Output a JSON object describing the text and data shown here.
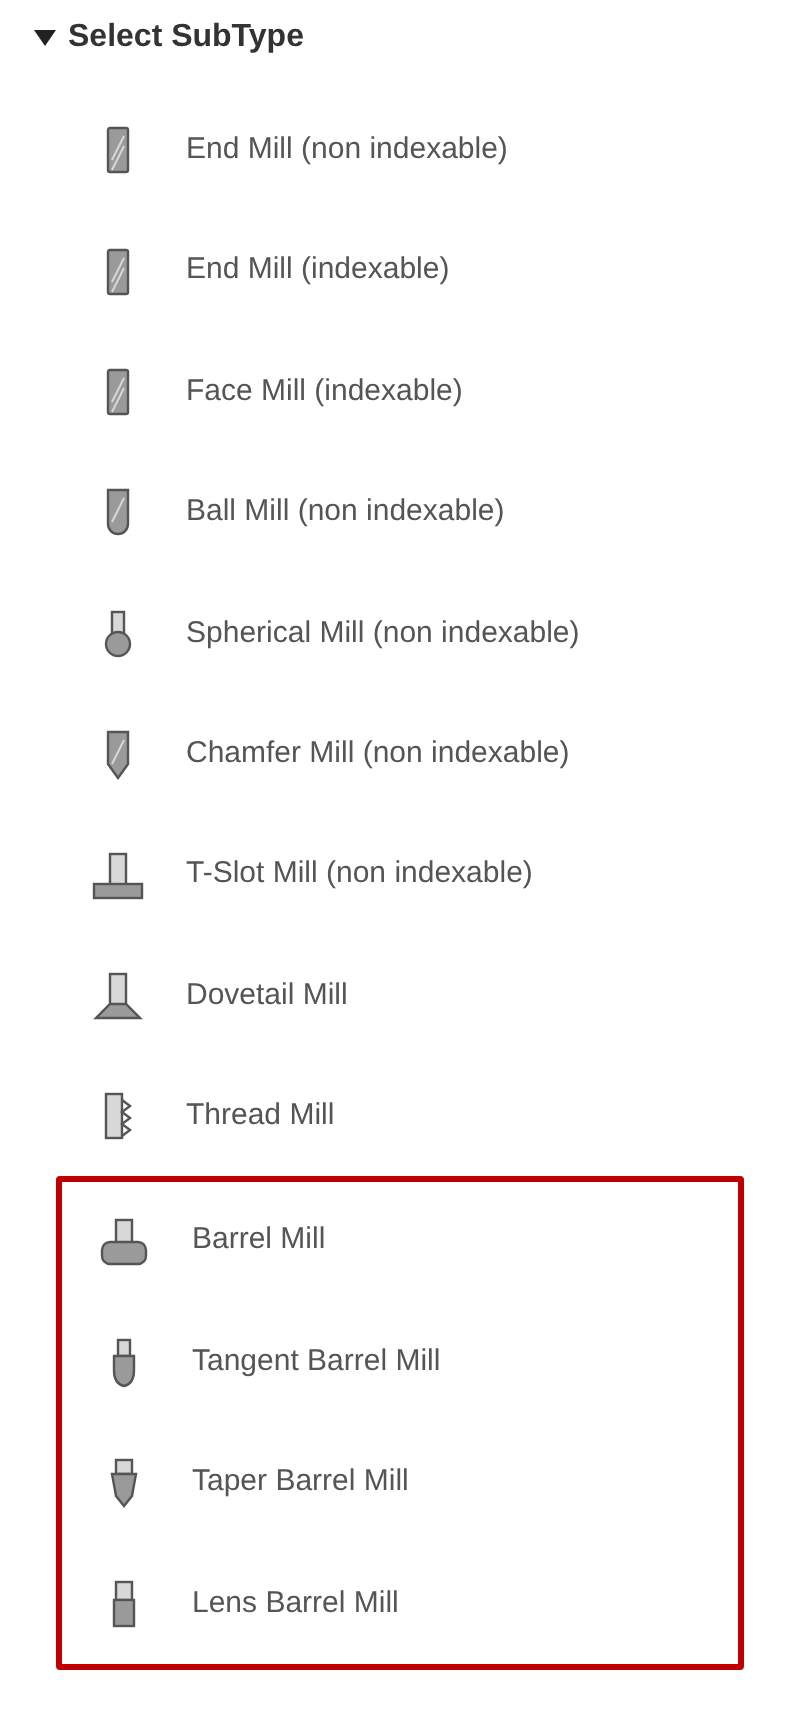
{
  "section": {
    "title": "Select SubType",
    "expanded": true
  },
  "groups": [
    {
      "outlined": false,
      "items": [
        {
          "label": "End Mill (non indexable)",
          "kind": "end"
        },
        {
          "label": "End Mill (indexable)",
          "kind": "end"
        },
        {
          "label": "Face Mill (indexable)",
          "kind": "end"
        },
        {
          "label": "Ball Mill (non indexable)",
          "kind": "ball"
        },
        {
          "label": "Spherical Mill (non indexable)",
          "kind": "spherical"
        },
        {
          "label": "Chamfer Mill (non indexable)",
          "kind": "chamfer"
        },
        {
          "label": "T-Slot Mill (non indexable)",
          "kind": "tslot"
        },
        {
          "label": "Dovetail Mill",
          "kind": "dovetail"
        },
        {
          "label": "Thread Mill",
          "kind": "thread"
        }
      ]
    },
    {
      "outlined": true,
      "items": [
        {
          "label": "Barrel Mill",
          "kind": "barrel"
        },
        {
          "label": "Tangent Barrel Mill",
          "kind": "tangent"
        },
        {
          "label": "Taper Barrel Mill",
          "kind": "taper"
        },
        {
          "label": "Lens Barrel Mill",
          "kind": "lens"
        }
      ]
    }
  ]
}
